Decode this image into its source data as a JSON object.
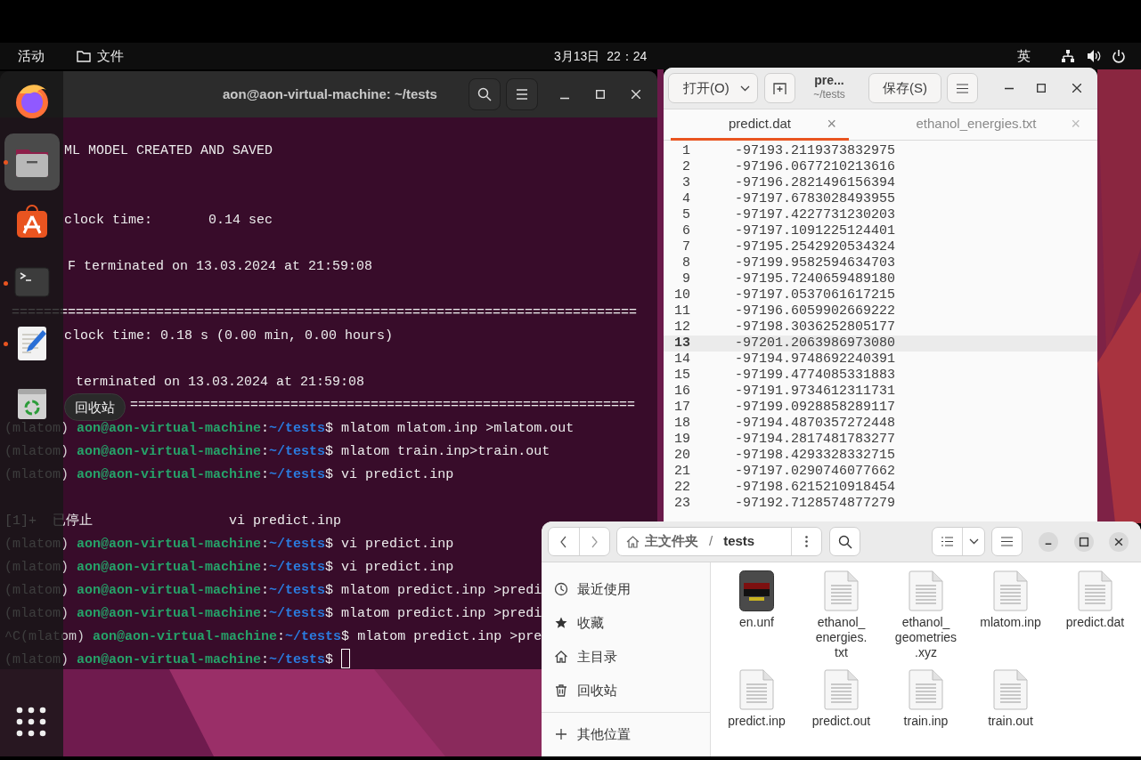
{
  "top_bar": {
    "activities": "活动",
    "app_menu": "文件",
    "clock": "3月13日  22：24",
    "input_method": "英"
  },
  "dock": {
    "items": [
      {
        "kind": "firefox",
        "running": false,
        "selected": false
      },
      {
        "kind": "files",
        "running": true,
        "selected": true
      },
      {
        "kind": "store",
        "running": false,
        "selected": false
      },
      {
        "kind": "terminal",
        "running": true,
        "selected": false
      },
      {
        "kind": "editor",
        "running": true,
        "selected": false
      },
      {
        "kind": "trash",
        "running": false,
        "selected": false
      }
    ],
    "tooltip": "回收站"
  },
  "terminal": {
    "title": "aon@aon-virtual-machine: ~/tests",
    "lines": [
      {
        "kind": "clipped",
        "text": "ML MODEL CREATED AND SAVED"
      },
      {
        "kind": "blank"
      },
      {
        "kind": "blank"
      },
      {
        "kind": "clipped",
        "text": "clock time:       0.14 sec"
      },
      {
        "kind": "blank"
      },
      {
        "kind": "after_icon",
        "text": "F terminated on 13.03.2024 at 21:59:08"
      },
      {
        "kind": "blank"
      },
      {
        "kind": "indented",
        "text": "=============================================================================="
      },
      {
        "kind": "clipped",
        "text": "clock time: 0.18 s (0.00 min, 0.00 hours)"
      },
      {
        "kind": "blank"
      },
      {
        "kind": "after_icon",
        "text": " terminated on 13.03.2024 at 21:59:08"
      },
      {
        "kind": "after_tooltip",
        "text": "==============================================================="
      },
      {
        "kind": "prompt",
        "env": "(mlatom)",
        "user": "aon@aon-virtual-machine",
        "sep": ":",
        "path": "~/tests",
        "sign": "$",
        "command": "mlatom mlatom.inp >mlatom.out",
        "cursor": false
      },
      {
        "kind": "prompt",
        "env": "(mlatom)",
        "user": "aon@aon-virtual-machine",
        "sep": ":",
        "path": "~/tests",
        "sign": "$",
        "command": "mlatom train.inp>train.out",
        "cursor": false
      },
      {
        "kind": "prompt",
        "env": "(mlatom)",
        "user": "aon@aon-virtual-machine",
        "sep": ":",
        "path": "~/tests",
        "sign": "$",
        "command": "vi predict.inp",
        "cursor": false
      },
      {
        "kind": "blank"
      },
      {
        "kind": "text",
        "text": "[1]+  已停止                 vi predict.inp"
      },
      {
        "kind": "prompt",
        "env": "(mlatom)",
        "user": "aon@aon-virtual-machine",
        "sep": ":",
        "path": "~/tests",
        "sign": "$",
        "command": "vi predict.inp",
        "cursor": false
      },
      {
        "kind": "prompt",
        "env": "(mlatom)",
        "user": "aon@aon-virtual-machine",
        "sep": ":",
        "path": "~/tests",
        "sign": "$",
        "command": "vi predict.inp",
        "cursor": false
      },
      {
        "kind": "prompt",
        "env": "(mlatom)",
        "user": "aon@aon-virtual-machine",
        "sep": ":",
        "path": "~/tests",
        "sign": "$",
        "command": "mlatom predict.inp >predi",
        "cursor": false
      },
      {
        "kind": "prompt",
        "env": "(mlatom)",
        "user": "aon@aon-virtual-machine",
        "sep": ":",
        "path": "~/tests",
        "sign": "$",
        "command": "mlatom predict.inp >predi",
        "cursor": false
      },
      {
        "kind": "prompt",
        "env": "^C(mlatom)",
        "user": "aon@aon-virtual-machine",
        "sep": ":",
        "path": "~/tests",
        "sign": "$",
        "command": "mlatom predict.inp >pre",
        "cursor": false
      },
      {
        "kind": "prompt",
        "env": "(mlatom)",
        "user": "aon@aon-virtual-machine",
        "sep": ":",
        "path": "~/tests",
        "sign": "$",
        "cursor": true
      }
    ]
  },
  "editor": {
    "open_button": "打开(O)",
    "title": "pre...",
    "subtitle": "~/tests",
    "save_button": "保存(S)",
    "tabs": [
      {
        "label": "predict.dat",
        "close": "×",
        "selected": true
      },
      {
        "label": "ethanol_energies.txt",
        "close": "×",
        "selected": false
      }
    ],
    "lines": [
      {
        "number": "1",
        "text": "-97193.2119373832975",
        "current": false
      },
      {
        "number": "2",
        "text": "-97196.0677210213616",
        "current": false
      },
      {
        "number": "3",
        "text": "-97196.2821496156394",
        "current": false
      },
      {
        "number": "4",
        "text": "-97197.6783028493955",
        "current": false
      },
      {
        "number": "5",
        "text": "-97197.4227731230203",
        "current": false
      },
      {
        "number": "6",
        "text": "-97197.1091225124401",
        "current": false
      },
      {
        "number": "7",
        "text": "-97195.2542920534324",
        "current": false
      },
      {
        "number": "8",
        "text": "-97199.9582594634703",
        "current": false
      },
      {
        "number": "9",
        "text": "-97195.7240659489180",
        "current": false
      },
      {
        "number": "10",
        "text": "-97197.0537061617215",
        "current": false
      },
      {
        "number": "11",
        "text": "-97196.6059902669222",
        "current": false
      },
      {
        "number": "12",
        "text": "-97198.3036252805177",
        "current": false
      },
      {
        "number": "13",
        "text": "-97201.2063986973080",
        "current": true
      },
      {
        "number": "14",
        "text": "-97194.9748692240391",
        "current": false
      },
      {
        "number": "15",
        "text": "-97199.4774085331883",
        "current": false
      },
      {
        "number": "16",
        "text": "-97191.9734612311731",
        "current": false
      },
      {
        "number": "17",
        "text": "-97199.0928858289117",
        "current": false
      },
      {
        "number": "18",
        "text": "-97194.4870357272448",
        "current": false
      },
      {
        "number": "19",
        "text": "-97194.2817481783277",
        "current": false
      },
      {
        "number": "20",
        "text": "-97198.4293328332715",
        "current": false
      },
      {
        "number": "21",
        "text": "-97197.0290746077662",
        "current": false
      },
      {
        "number": "22",
        "text": "-97198.6215210918454",
        "current": false
      },
      {
        "number": "23",
        "text": "-97192.7128574877279",
        "current": false
      }
    ]
  },
  "files": {
    "path": [
      {
        "label": "主文件夹",
        "kind": "home"
      },
      {
        "label": "/",
        "kind": "sep"
      },
      {
        "label": "tests",
        "kind": "current"
      }
    ],
    "sidebar": [
      {
        "label": "最近使用",
        "kind": "recent"
      },
      {
        "label": "收藏",
        "kind": "starred"
      },
      {
        "label": "主目录",
        "kind": "home"
      },
      {
        "label": "回收站",
        "kind": "trash"
      },
      {
        "label": "其他位置",
        "kind": "other"
      }
    ],
    "items": [
      {
        "name": "en.unf",
        "kind": "binary"
      },
      {
        "name": "ethanol_\nenergies.\ntxt",
        "kind": "text"
      },
      {
        "name": "ethanol_\ngeometries\n.xyz",
        "kind": "text"
      },
      {
        "name": "mlatom.inp",
        "kind": "text"
      },
      {
        "name": "predict.dat",
        "kind": "text"
      },
      {
        "name": "predict.inp",
        "kind": "text"
      },
      {
        "name": "predict.out",
        "kind": "text"
      },
      {
        "name": "train.inp",
        "kind": "text"
      },
      {
        "name": "train.out",
        "kind": "text"
      }
    ]
  }
}
